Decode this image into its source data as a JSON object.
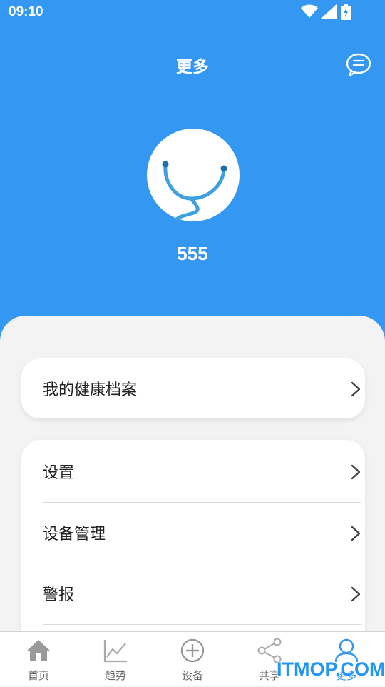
{
  "status_bar": {
    "time": "09:10"
  },
  "header": {
    "title": "更多"
  },
  "profile": {
    "name": "555"
  },
  "health_card": {
    "label": "我的健康档案"
  },
  "menu": [
    {
      "label": "设置"
    },
    {
      "label": "设备管理"
    },
    {
      "label": "警报"
    }
  ],
  "tabs": [
    {
      "label": "首页",
      "icon": "home-icon"
    },
    {
      "label": "趋势",
      "icon": "trend-icon"
    },
    {
      "label": "设备",
      "icon": "plus-circle-icon"
    },
    {
      "label": "共享",
      "icon": "share-icon"
    },
    {
      "label": "更多",
      "icon": "user-icon",
      "active": true
    }
  ],
  "watermark": "ITMOP.COM",
  "colors": {
    "primary": "#3498f3",
    "background": "#f3f3f3"
  }
}
